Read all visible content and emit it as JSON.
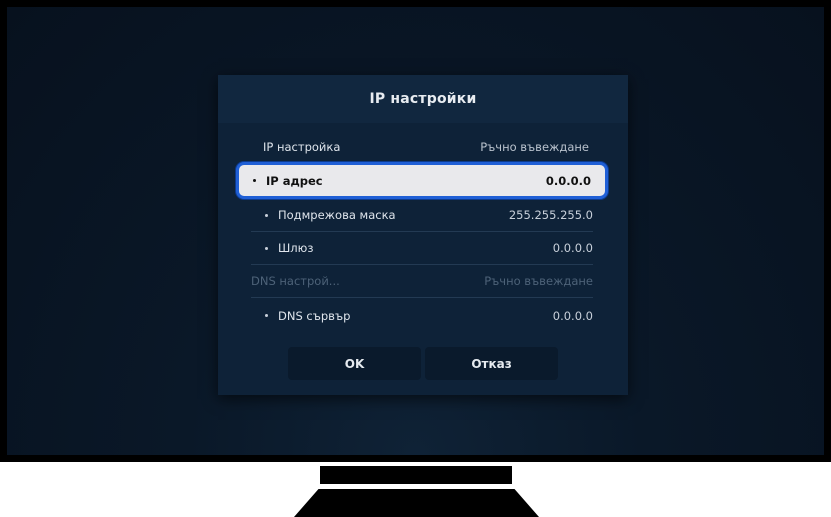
{
  "dialog": {
    "title": "IP настройки",
    "rows": [
      {
        "label": "IP настройка",
        "value": "Ръчно въвеждане"
      },
      {
        "label": "IP адрес",
        "value": "0.0.0.0"
      },
      {
        "label": "Подмрежова маска",
        "value": "255.255.255.0"
      },
      {
        "label": "Шлюз",
        "value": "0.0.0.0"
      },
      {
        "label": "DNS настрой...",
        "value": "Ръчно въвеждане"
      },
      {
        "label": "DNS сървър",
        "value": "0.0.0.0"
      }
    ],
    "buttons": {
      "ok": "OK",
      "cancel": "Отказ"
    }
  },
  "colors": {
    "focus_border": "#1f5fd6",
    "selected_bg": "#e9e9ec",
    "dialog_bg": "#0e2238"
  }
}
